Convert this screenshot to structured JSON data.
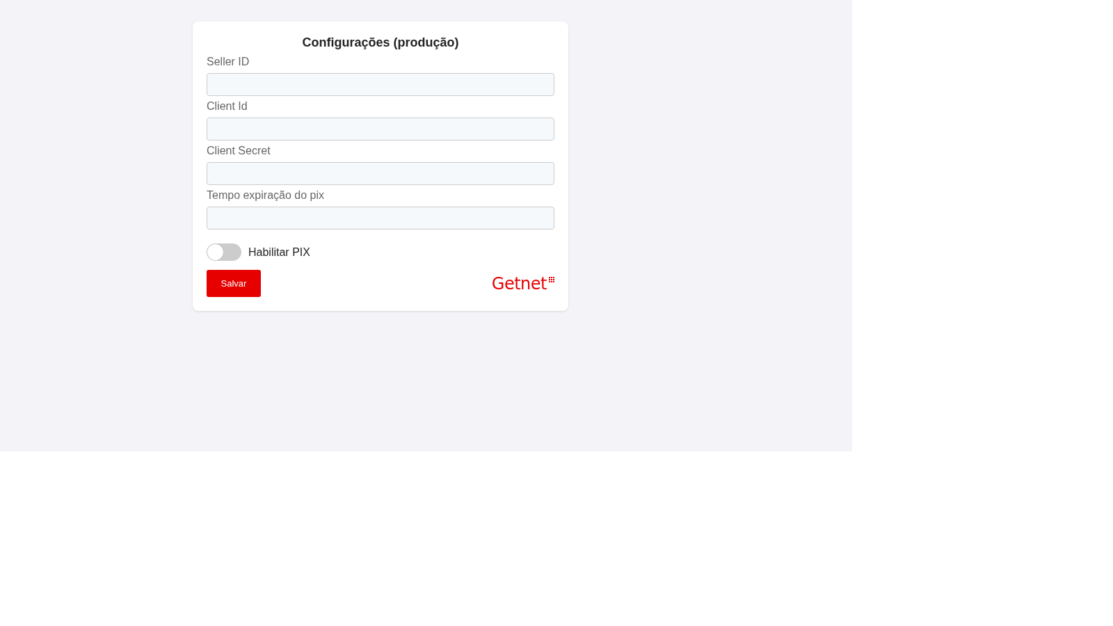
{
  "title": "Configurações (produção)",
  "fields": [
    {
      "label": "Seller ID"
    },
    {
      "label": "Client Id"
    },
    {
      "label": "Client Secret"
    },
    {
      "label": "Tempo expiração do pix"
    }
  ],
  "toggle": {
    "label": "Habilitar PIX",
    "on": false
  },
  "save_button": "Salvar",
  "logo": "Getnet"
}
